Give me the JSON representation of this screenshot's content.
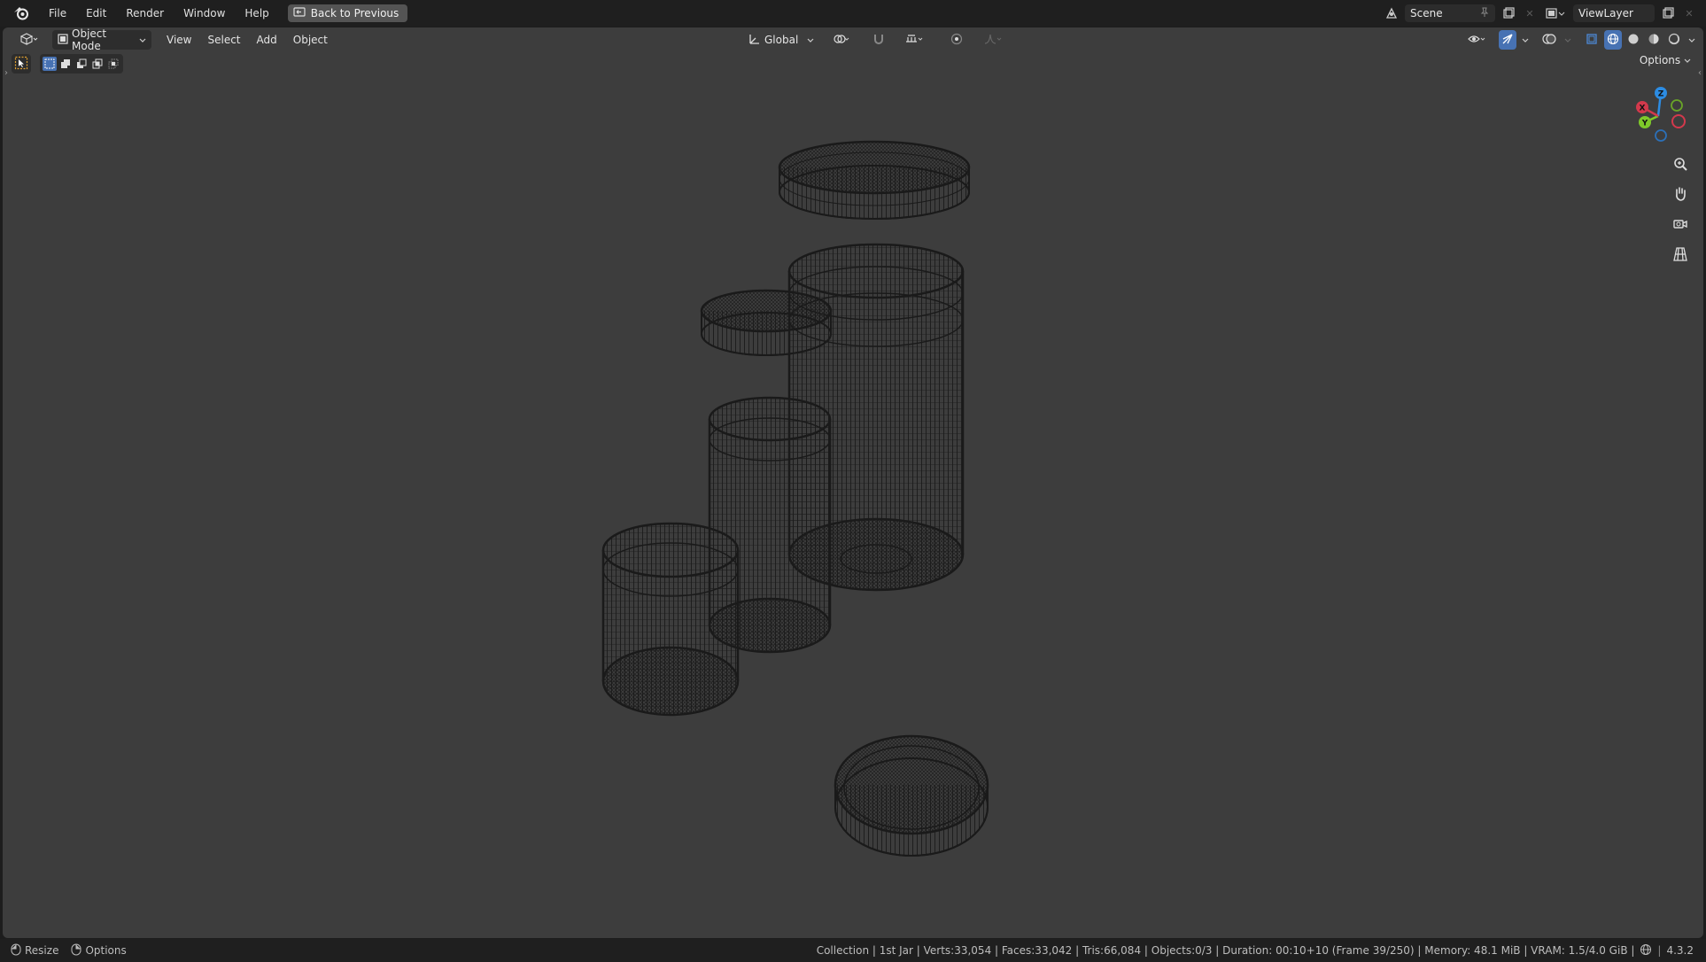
{
  "menubar": {
    "items": [
      "File",
      "Edit",
      "Render",
      "Window",
      "Help"
    ],
    "back_button": "Back to Previous",
    "scene_name": "Scene",
    "view_layer": "ViewLayer"
  },
  "viewport_header": {
    "mode": "Object Mode",
    "menus": [
      "View",
      "Select",
      "Add",
      "Object"
    ],
    "transform_orientation": "Global",
    "options_label": "Options"
  },
  "viewport": {
    "background_color": "#3d3d3d",
    "wire_color": "#1a1a1a",
    "shading": "wireframe",
    "axes": {
      "x_color": "#d3394c",
      "y_color": "#7ec92a",
      "z_color": "#2c8ce3"
    },
    "axis_labels": {
      "x": "X",
      "y": "Y",
      "z": "Z"
    }
  },
  "statusbar": {
    "left": [
      {
        "icon": "mouse-left-icon",
        "label": "Resize"
      },
      {
        "icon": "mouse-right-icon",
        "label": "Options"
      }
    ],
    "stats": "Collection | 1st Jar | Verts:33,054 | Faces:33,042 | Tris:66,084 | Objects:0/3 | Duration: 00:10+10 (Frame 39/250) | Memory: 48.1 MiB | VRAM: 1.5/4.0 GiB |",
    "version": "4.3.2"
  },
  "colors": {
    "active_accent": "#4772b3",
    "bar_background": "#1f1f1f"
  }
}
